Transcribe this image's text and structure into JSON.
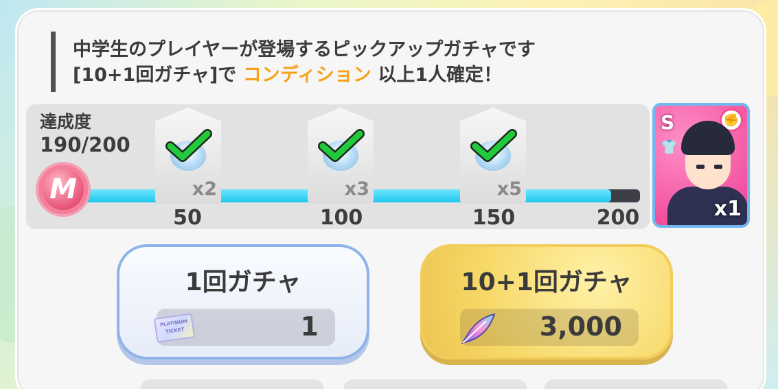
{
  "description": {
    "line1": "中学生のプレイヤーが登場するピックアップガチャです",
    "line2_prefix": "[10+1回ガチャ]で ",
    "line2_highlight": "コンディション",
    "line2_suffix": " 以上1人確定！"
  },
  "achievement": {
    "label": "達成度",
    "value": "190/200",
    "current": 190,
    "max": 200,
    "coin_letter": "M",
    "milestones": [
      {
        "tick": "50",
        "multiplier": "x2",
        "claimed": true
      },
      {
        "tick": "100",
        "multiplier": "x3",
        "claimed": true
      },
      {
        "tick": "150",
        "multiplier": "x5",
        "claimed": true
      }
    ],
    "end_tick": "200"
  },
  "reward_card": {
    "rank": "S",
    "count": "x1"
  },
  "buttons": {
    "single": {
      "title": "1回ガチャ",
      "cost": "1",
      "ticket_text": "PLATINUM TICKET"
    },
    "multi": {
      "title": "10+1回ガチャ",
      "cost": "3,000"
    }
  },
  "colors": {
    "highlight": "#f6a21a",
    "bar_fill": "#20c7ef",
    "check": "#22c93a"
  }
}
